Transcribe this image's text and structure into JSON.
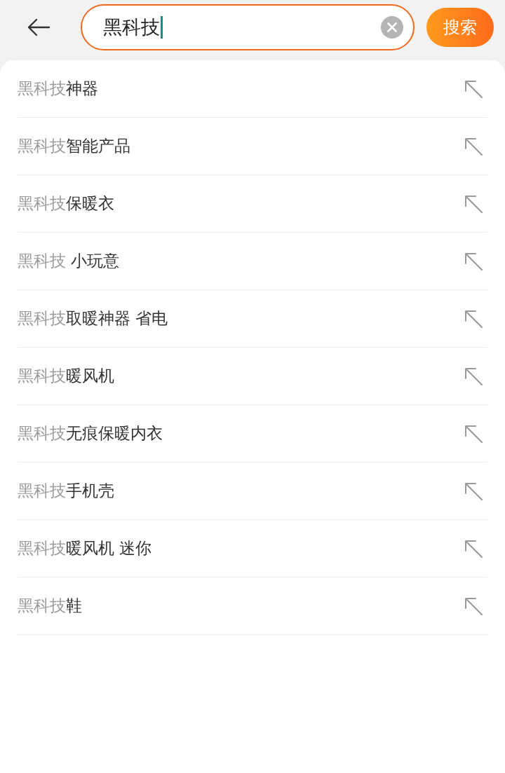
{
  "search": {
    "value": "黑科技",
    "button": "搜索"
  },
  "suggestions": [
    {
      "match": "黑科技",
      "rest": "神器"
    },
    {
      "match": "黑科技",
      "rest": "智能产品"
    },
    {
      "match": "黑科技",
      "rest": "保暖衣"
    },
    {
      "match": "黑科技",
      "rest": " 小玩意"
    },
    {
      "match": "黑科技",
      "rest": "取暖神器 省电"
    },
    {
      "match": "黑科技",
      "rest": "暖风机"
    },
    {
      "match": "黑科技",
      "rest": "无痕保暖内衣"
    },
    {
      "match": "黑科技",
      "rest": "手机壳"
    },
    {
      "match": "黑科技",
      "rest": "暖风机 迷你"
    },
    {
      "match": "黑科技",
      "rest": "鞋"
    }
  ]
}
